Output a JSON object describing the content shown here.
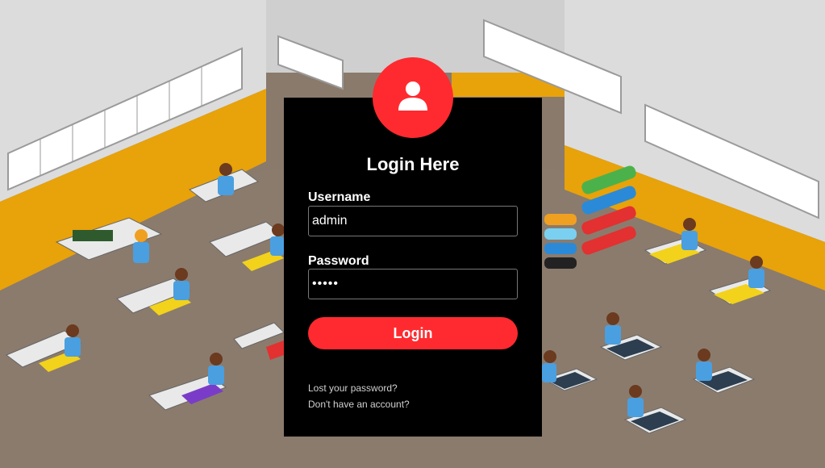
{
  "background": {
    "image_description": "factory-floor-illustration",
    "colors": {
      "wall": "#d9d9d9",
      "wall_stripe": "#e8a20a",
      "floor": "#8a7a6c",
      "table_yellow": "#f2d21b",
      "fabric_red": "#e33030",
      "fabric_blue": "#2a8ad8",
      "fabric_green": "#4bb24b",
      "worker_shirt": "#4a9fe0"
    }
  },
  "login": {
    "title": "Login Here",
    "avatar_icon": "user-icon",
    "username_label": "Username",
    "username_value": "admin",
    "password_label": "Password",
    "password_value": "•••••",
    "submit_label": "Login",
    "lost_password_link": "Lost your password?",
    "signup_link": "Don't have an account?"
  },
  "colors": {
    "accent": "#ff2a2f",
    "panel": "#000000",
    "text": "#ffffff"
  }
}
